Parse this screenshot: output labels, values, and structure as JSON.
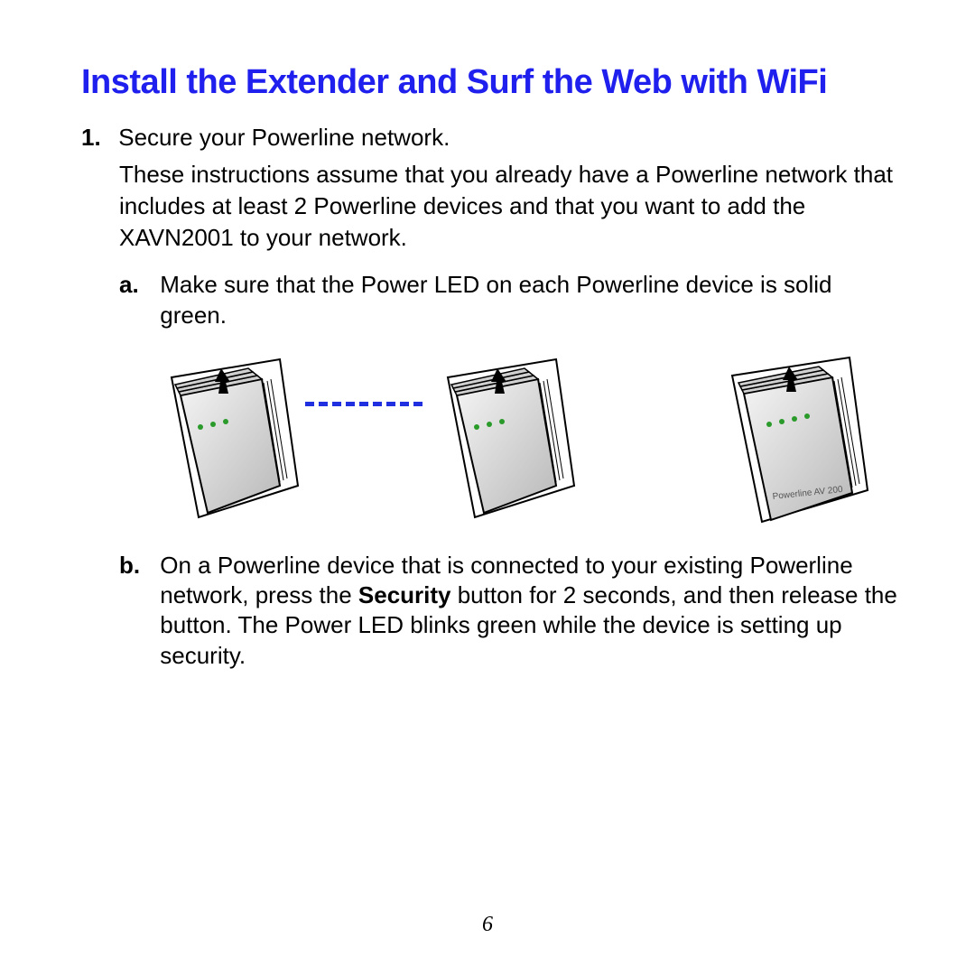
{
  "title": "Install the Extender and Surf the Web with WiFi",
  "step1": {
    "num": "1.",
    "lead": "Secure your Powerline network.",
    "desc": "These instructions assume that you already have a Powerline network that includes at least 2 Powerline devices and that you want to add the XAVN2001 to your network."
  },
  "sub_a": {
    "letter": "a.",
    "text": "Make sure that the Power LED on each Powerline device is solid green."
  },
  "sub_b": {
    "letter": "b.",
    "pre": "On a Powerline device that is connected to your existing Powerline network, press the ",
    "bold": "Security",
    "post": " button for 2 seconds, and then release the button. The Power LED blinks green while the device is setting up security."
  },
  "page_number": "6"
}
